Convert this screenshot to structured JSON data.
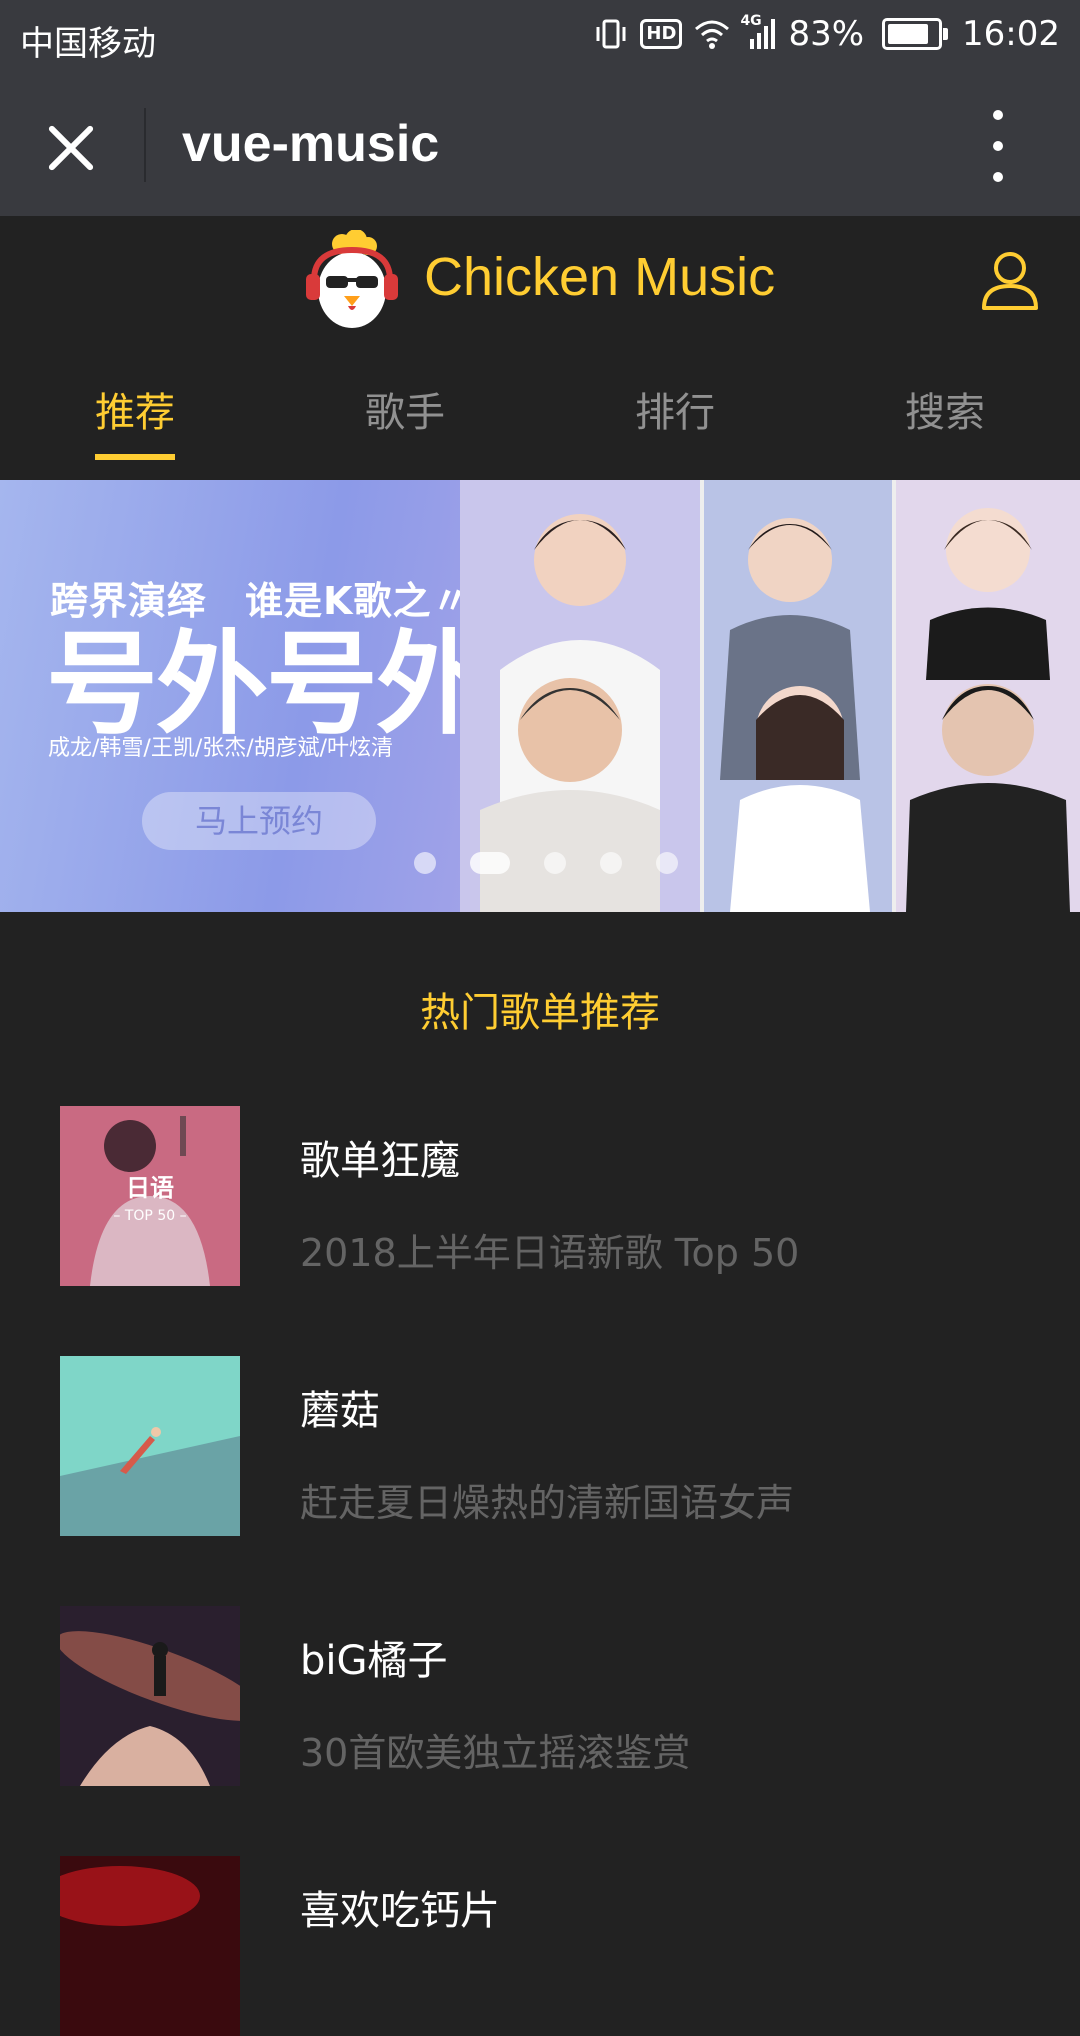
{
  "status_bar": {
    "carrier": "中国移动",
    "hd": "HD",
    "network": "4G",
    "battery": "83%",
    "battery_level": 0.83,
    "time": "16:02"
  },
  "topbar": {
    "title": "vue-music"
  },
  "header": {
    "app_title": "Chicken Music",
    "accent_color": "#ffcd32"
  },
  "tabs": [
    {
      "label": "推荐",
      "active": true
    },
    {
      "label": "歌手",
      "active": false
    },
    {
      "label": "排行",
      "active": false
    },
    {
      "label": "搜索",
      "active": false
    }
  ],
  "banner": {
    "headline": "跨界演绎　谁是K歌之〃神〃",
    "big_title": "号外号外",
    "names": "成龙/韩雪/王凯/张杰/胡彦斌/叶炫清",
    "cta": "马上预约",
    "dot_count": 5,
    "active_dot": 1
  },
  "section": {
    "title": "热门歌单推荐"
  },
  "playlists": [
    {
      "name": "歌单狂魔",
      "desc": "2018上半年日语新歌 Top 50",
      "cover_text": "日语",
      "cover_sub": "– TOP 50 –"
    },
    {
      "name": "蘑菇",
      "desc": "赶走夏日燥热的清新国语女声"
    },
    {
      "name": "biG橘子",
      "desc": "30首欧美独立摇滚鉴赏"
    },
    {
      "name": "喜欢吃钙片",
      "desc": ""
    }
  ]
}
